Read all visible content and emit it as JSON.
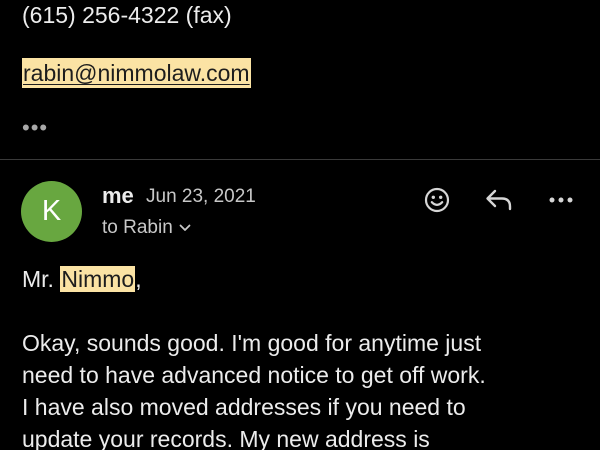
{
  "previous_message": {
    "fax_line": "(615) 256-4322 (fax)",
    "email": "rabin@nimmolaw.com",
    "show_trimmed_label": "•••"
  },
  "message": {
    "avatar_initial": "K",
    "avatar_color": "#68a740",
    "sender": "me",
    "date": "Jun 23, 2021",
    "recipient": "to Rabin",
    "salutation_prefix": "Mr. ",
    "salutation_highlight": "Nimmo",
    "salutation_suffix": ",",
    "body_lines": [
      "Okay, sounds good. I'm good for anytime just",
      "need to have advanced notice to get off work.",
      "I have also moved addresses if you need to",
      "update your records. My new address is"
    ]
  },
  "actions": {
    "emoji_icon": "emoji-react-icon",
    "reply_icon": "reply-icon",
    "more_icon": "more-options-icon"
  },
  "colors": {
    "background": "#000000",
    "highlight": "#fbe3a4",
    "avatar": "#68a740",
    "divider": "#3a3a3a"
  }
}
